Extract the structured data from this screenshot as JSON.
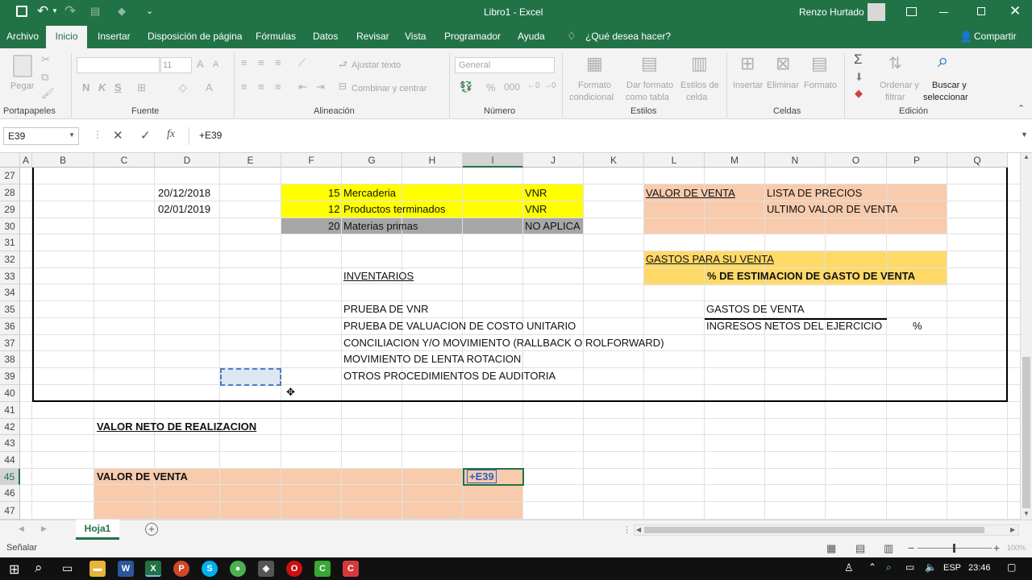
{
  "window": {
    "title": "Libro1 - Excel",
    "user": "Renzo Hurtado"
  },
  "tabs": [
    "Archivo",
    "Inicio",
    "Insertar",
    "Disposición de página",
    "Fórmulas",
    "Datos",
    "Revisar",
    "Vista",
    "Programador",
    "Ayuda",
    "¿Qué desea hacer?"
  ],
  "share": "Compartir",
  "ribbon": {
    "portapapeles": {
      "label": "Portapapeles",
      "pegar": "Pegar"
    },
    "fuente": {
      "label": "Fuente",
      "size": "11",
      "bold": "N",
      "italic": "K",
      "underline": "S"
    },
    "alineacion": {
      "label": "Alineación",
      "ajustar": "Ajustar texto",
      "combinar": "Combinar y centrar"
    },
    "numero": {
      "label": "Número",
      "format": "General"
    },
    "estilos": {
      "label": "Estilos",
      "cond1": "Formato",
      "cond2": "condicional",
      "tabla1": "Dar formato",
      "tabla2": "como tabla",
      "celda1": "Estilos de",
      "celda2": "celda"
    },
    "celdas": {
      "label": "Celdas",
      "insertar": "Insertar",
      "eliminar": "Eliminar",
      "formato": "Formato"
    },
    "edicion": {
      "label": "Edición",
      "ordenar1": "Ordenar y",
      "ordenar2": "filtrar",
      "buscar1": "Buscar y",
      "buscar2": "seleccionar"
    }
  },
  "formula_bar": {
    "name_box": "E39",
    "formula": "+E39"
  },
  "columns": [
    "A",
    "B",
    "C",
    "D",
    "E",
    "F",
    "G",
    "H",
    "I",
    "J",
    "K",
    "L",
    "M",
    "N",
    "O",
    "P",
    "Q"
  ],
  "rows": [
    "27",
    "28",
    "29",
    "30",
    "31",
    "32",
    "33",
    "34",
    "35",
    "36",
    "37",
    "38",
    "39",
    "40",
    "41",
    "42",
    "43",
    "44",
    "45",
    "46",
    "47"
  ],
  "cells": {
    "d28": "20/12/2018",
    "d29": "02/01/2019",
    "f28": "15",
    "g28": "Mercaderia",
    "j28": "VNR",
    "f29": "12",
    "g29": "Productos terminados",
    "j29": "VNR",
    "f30": "20",
    "g30": "Materias primas",
    "j30": "NO APLICA",
    "l28": "VALOR DE VENTA",
    "n28": "LISTA DE PRECIOS",
    "n29": "ULTIMO VALOR DE VENTA",
    "l32": "GASTOS PARA SU VENTA",
    "m33": "% DE ESTIMACION DE GASTO DE VENTA",
    "g33": "INVENTARIOS",
    "g35": "PRUEBA DE VNR",
    "g36": "PRUEBA DE VALUACION DE COSTO UNITARIO",
    "g37": "CONCILIACION Y/O MOVIMIENTO (RALLBACK O ROLFORWARD)",
    "g38": "MOVIMIENTO DE LENTA ROTACION",
    "g39": "OTROS PROCEDIMIENTOS DE AUDITORIA",
    "m35": "GASTOS DE VENTA",
    "m36": "INGRESOS NETOS DEL EJERCICIO",
    "p36": "%",
    "c42": "VALOR NETO DE REALIZACION",
    "c45": "VALOR DE VENTA",
    "i45": "+E39"
  },
  "sheet": {
    "name": "Hoja1"
  },
  "status": {
    "mode": "Señalar",
    "zoom": "100%"
  },
  "taskbar": {
    "lang": "ESP",
    "time": "23:46"
  },
  "colors": {
    "excel_green": "#217346",
    "yellow": "#ffff00",
    "grey": "#a6a6a6",
    "peach": "#f8cbad",
    "gold": "#ffd966"
  }
}
